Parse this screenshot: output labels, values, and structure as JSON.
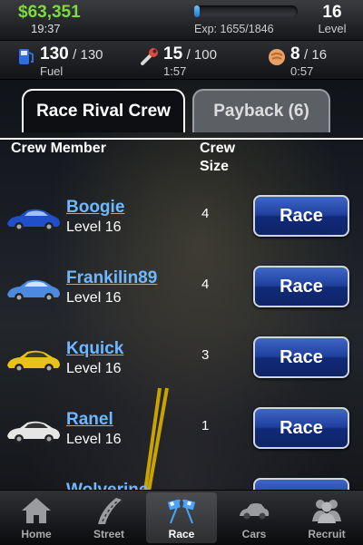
{
  "status": {
    "money": "$63,351",
    "clock": "19:37",
    "exp_text": "Exp: 1655/1846",
    "exp_progress": 0.0526,
    "level": "16",
    "level_label": "Level"
  },
  "resources": {
    "fuel": {
      "current": "130",
      "max": "/ 130",
      "label": "Fuel",
      "icon": "fuel-pump-icon"
    },
    "repair": {
      "current": "15",
      "max": "/ 100",
      "timer": "1:57",
      "icon": "wrench-icon"
    },
    "tokens": {
      "current": "8",
      "max": "/ 16",
      "timer": "0:57",
      "icon": "fist-icon"
    }
  },
  "tabs": [
    {
      "label": "Race Rival Crew",
      "active": true
    },
    {
      "label": "Payback (6)",
      "active": false
    }
  ],
  "columns": {
    "member": "Crew Member",
    "size_line1": "Crew",
    "size_line2": "Size"
  },
  "rows": [
    {
      "name": "Boogie",
      "level": "Level 16",
      "size": "4",
      "button": "Race",
      "car_color": "#1f4fc9"
    },
    {
      "name": "Frankilin89",
      "level": "Level 16",
      "size": "4",
      "button": "Race",
      "car_color": "#4a8ae0"
    },
    {
      "name": "Kquick",
      "level": "Level 16",
      "size": "3",
      "button": "Race",
      "car_color": "#e8c21a"
    },
    {
      "name": "Ranel",
      "level": "Level 16",
      "size": "1",
      "button": "Race",
      "car_color": "#e6e6e6"
    },
    {
      "name": "Wolverine",
      "level": "",
      "size": "",
      "button": "Race",
      "car_color": "#2a4fb5"
    }
  ],
  "nav": [
    {
      "label": "Home",
      "icon": "home-icon",
      "active": false
    },
    {
      "label": "Street",
      "icon": "road-icon",
      "active": false
    },
    {
      "label": "Race",
      "icon": "checkered-flags-icon",
      "active": true
    },
    {
      "label": "Cars",
      "icon": "car-icon",
      "active": false
    },
    {
      "label": "Recruit",
      "icon": "people-icon",
      "active": false
    }
  ],
  "colors": {
    "money": "#7cdc3a",
    "link": "#6fb8ff",
    "button": "#1f3f9c"
  }
}
